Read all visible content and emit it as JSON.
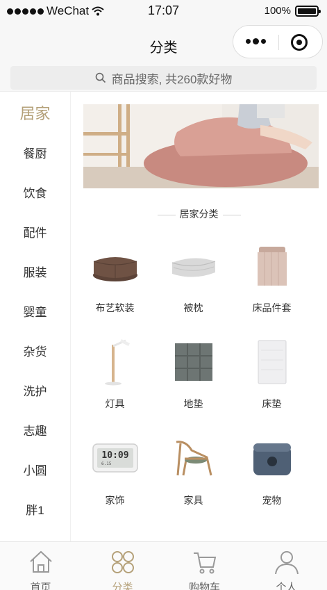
{
  "status_bar": {
    "carrier": "WeChat",
    "time": "17:07",
    "battery": "100%"
  },
  "nav": {
    "title": "分类"
  },
  "search": {
    "placeholder": "商品搜索, 共260款好物"
  },
  "sidebar": {
    "items": [
      {
        "label": "居家",
        "active": true
      },
      {
        "label": "餐厨"
      },
      {
        "label": "饮食"
      },
      {
        "label": "配件"
      },
      {
        "label": "服装"
      },
      {
        "label": "婴童"
      },
      {
        "label": "杂货"
      },
      {
        "label": "洗护"
      },
      {
        "label": "志趣"
      },
      {
        "label": "小圆"
      },
      {
        "label": "胖1"
      }
    ]
  },
  "main": {
    "section_title": "居家分类",
    "categories": [
      {
        "label": "布艺软装",
        "icon": "pouf-icon"
      },
      {
        "label": "被枕",
        "icon": "quilt-icon"
      },
      {
        "label": "床品件套",
        "icon": "bedding-set-icon"
      },
      {
        "label": "灯具",
        "icon": "lamp-icon"
      },
      {
        "label": "地垫",
        "icon": "floor-mat-icon"
      },
      {
        "label": "床垫",
        "icon": "mattress-icon"
      },
      {
        "label": "家饰",
        "icon": "clock-icon"
      },
      {
        "label": "家具",
        "icon": "chair-icon"
      },
      {
        "label": "宠物",
        "icon": "pet-house-icon"
      }
    ],
    "clock_display": {
      "time": "10:09",
      "date": "6.15"
    }
  },
  "tabbar": {
    "items": [
      {
        "label": "首页",
        "icon": "home-icon"
      },
      {
        "label": "分类",
        "icon": "category-icon",
        "active": true
      },
      {
        "label": "购物车",
        "icon": "cart-icon"
      },
      {
        "label": "个人",
        "icon": "user-icon"
      }
    ]
  },
  "colors": {
    "accent": "#b4a078",
    "banner_pouf": "#d49a8e"
  }
}
